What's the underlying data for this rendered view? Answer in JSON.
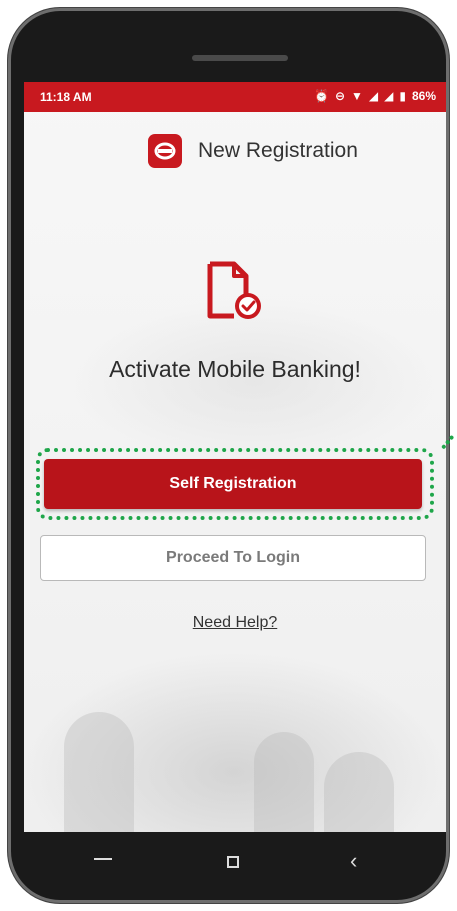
{
  "status_bar": {
    "time": "11:18 AM",
    "battery": "86%",
    "icons": [
      "alarm-icon",
      "dnd-icon",
      "wifi-icon",
      "signal-icon",
      "signal-icon",
      "battery-icon"
    ]
  },
  "header": {
    "title": "New Registration",
    "logo": "bank-logo-icon"
  },
  "main": {
    "icon": "document-check-icon",
    "headline": "Activate Mobile Banking!",
    "primary_button": "Self Registration",
    "secondary_button": "Proceed To Login",
    "help_link": "Need Help?"
  },
  "nav": {
    "items": [
      "back-icon",
      "home-icon",
      "recent-icon"
    ]
  },
  "colors": {
    "brand": "#c8191f",
    "button": "#b8141a",
    "highlight": "#1fa64a"
  }
}
